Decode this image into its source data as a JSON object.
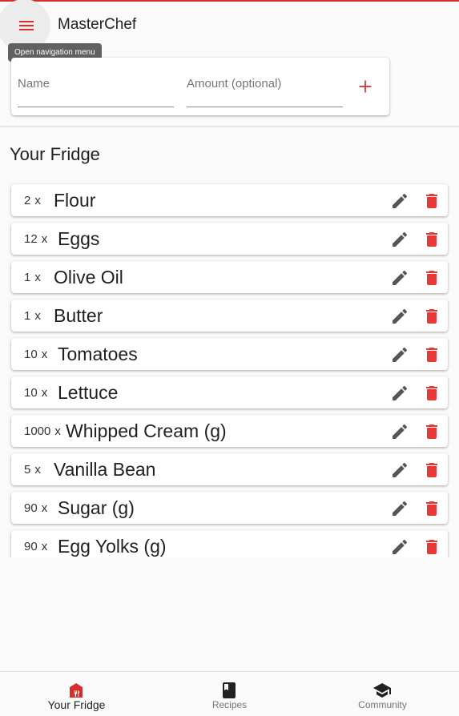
{
  "app": {
    "title": "MasterChef",
    "accent_color": "#d32f2f",
    "menu_tooltip": "Open navigation menu",
    "menu_icon": "menu-icon"
  },
  "add_form": {
    "name_placeholder": "Name",
    "amount_placeholder": "Amount (optional)",
    "add_icon": "plus-icon"
  },
  "fridge": {
    "title": "Your Fridge",
    "items": [
      {
        "qty": "2",
        "unit": "x",
        "name": "Flour"
      },
      {
        "qty": "12",
        "unit": "x",
        "name": "Eggs"
      },
      {
        "qty": "1",
        "unit": "x",
        "name": "Olive Oil"
      },
      {
        "qty": "1",
        "unit": "x",
        "name": "Butter"
      },
      {
        "qty": "10",
        "unit": "x",
        "name": "Tomatoes"
      },
      {
        "qty": "10",
        "unit": "x",
        "name": "Lettuce"
      },
      {
        "qty": "1000",
        "unit": "x",
        "name": "Whipped Cream (g)"
      },
      {
        "qty": "5",
        "unit": "x",
        "name": "Vanilla Bean"
      },
      {
        "qty": "90",
        "unit": "x",
        "name": "Sugar (g)"
      },
      {
        "qty": "90",
        "unit": "x",
        "name": "Egg Yolks (g)"
      }
    ],
    "edit_icon": "pencil-icon",
    "delete_icon": "trash-icon",
    "delete_color": "#e53935"
  },
  "bottom_nav": {
    "items": [
      {
        "label": "Your Fridge",
        "icon": "fridge-icon",
        "active": true
      },
      {
        "label": "Recipes",
        "icon": "book-icon",
        "active": false
      },
      {
        "label": "Community",
        "icon": "school-icon",
        "active": false
      }
    ]
  }
}
